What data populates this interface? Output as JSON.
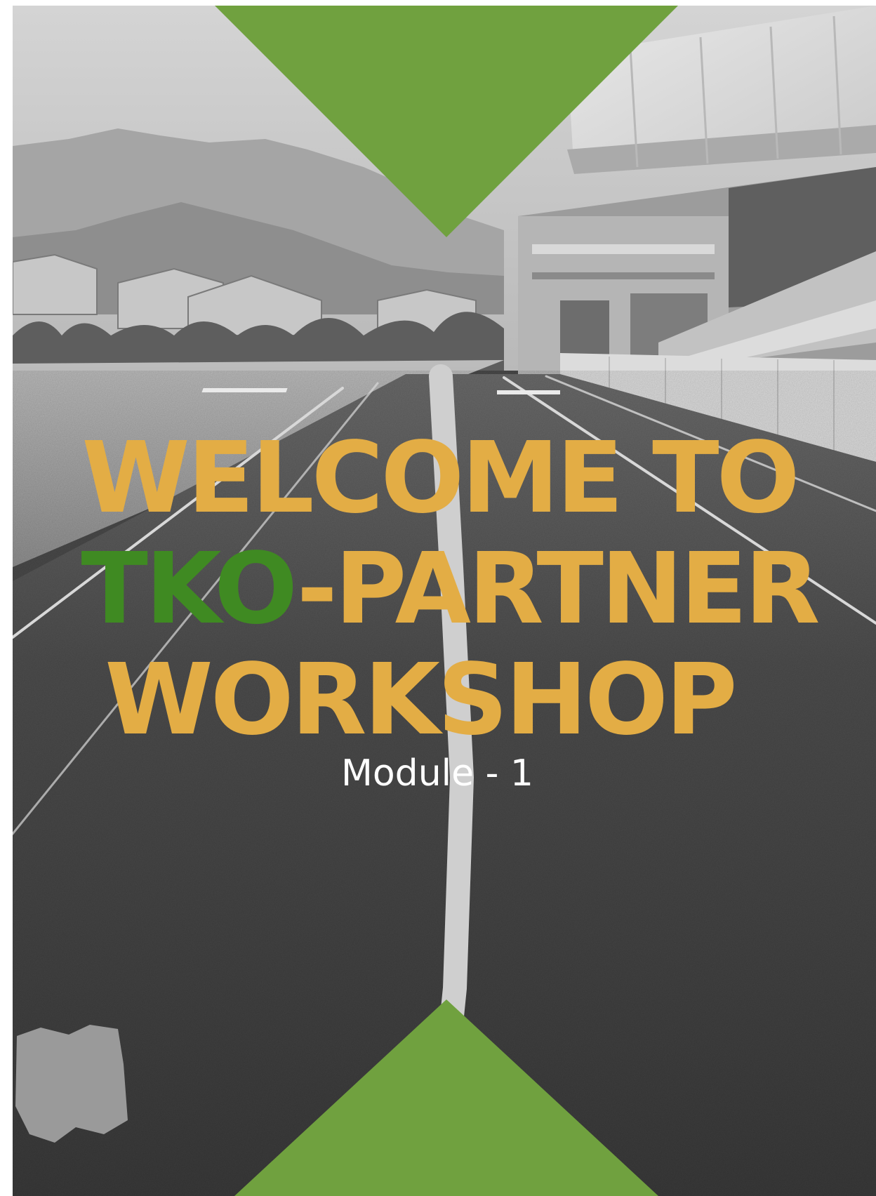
{
  "cover": {
    "title_line1": "WELCOME TO",
    "title_line2_highlight": "TKO",
    "title_line2_rest": "-PARTNER",
    "title_line3": "WORKSHOP",
    "subtitle": "Module - 1"
  },
  "colors": {
    "gold": "#E3AD45",
    "green_text": "#3F8A22",
    "green_triangle": "#70A13F",
    "subtitle": "#FFFFFF"
  }
}
